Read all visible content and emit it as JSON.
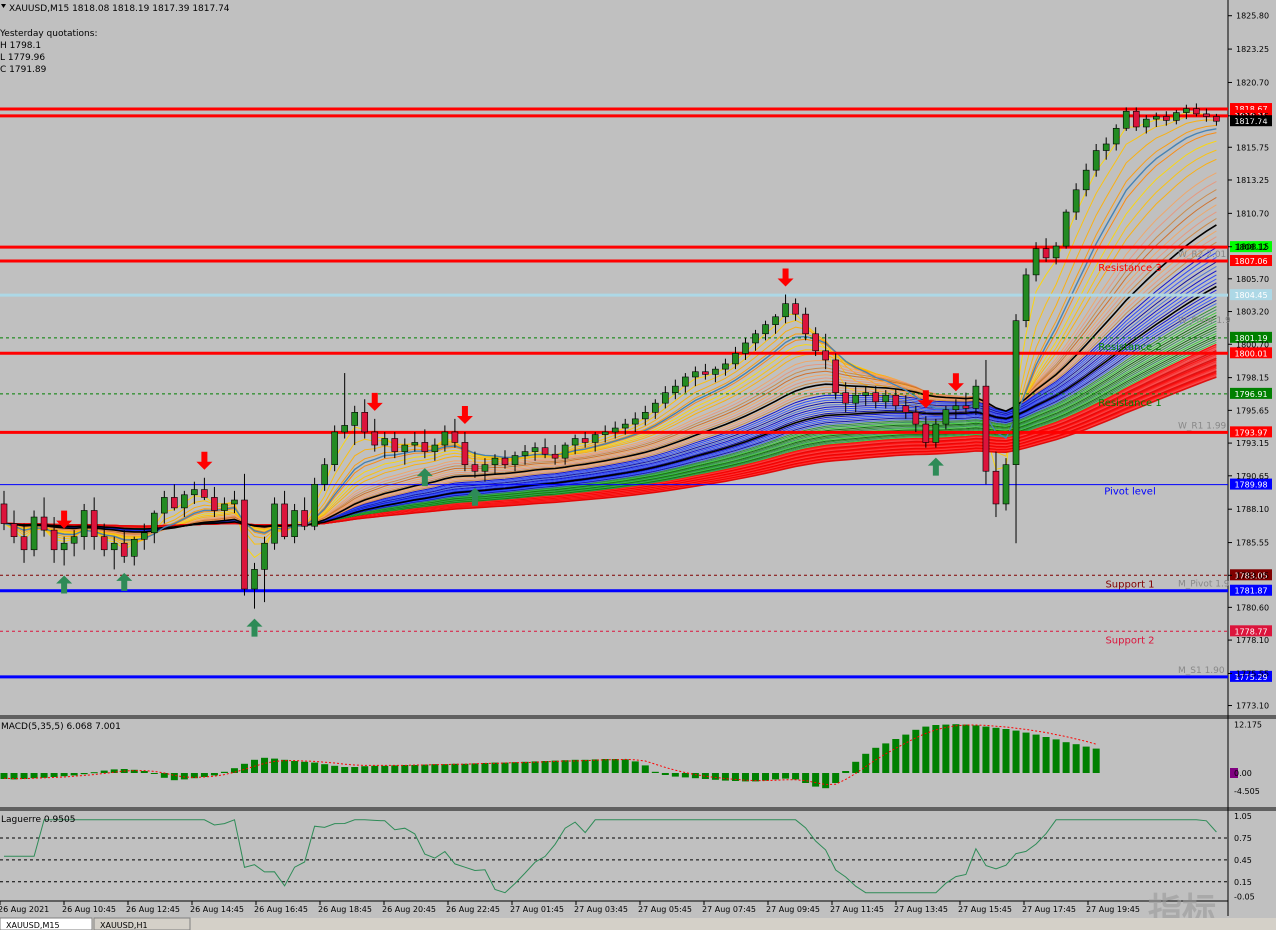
{
  "header": {
    "symbol_line": "XAUUSD,M15  1818.08 1818.19 1817.39 1817.74",
    "yesterday_title": "Yesterday quotations:",
    "yesterday_h": "H 1798.1",
    "yesterday_l": "L 1779.96",
    "yesterday_c": "C 1791.89"
  },
  "price_axis": {
    "ticks": [
      "1825.80",
      "1823.25",
      "1820.70",
      "1818.15",
      "1815.75",
      "1813.25",
      "1810.70",
      "1808.15",
      "1805.70",
      "1803.20",
      "1800.70",
      "1798.15",
      "1795.65",
      "1793.15",
      "1790.65",
      "1788.10",
      "1785.55",
      "1783.05",
      "1780.60",
      "1778.10",
      "1775.55",
      "1773.10"
    ],
    "tick_values": [
      1825.8,
      1823.25,
      1820.7,
      1818.15,
      1815.75,
      1813.25,
      1810.7,
      1808.15,
      1805.7,
      1803.2,
      1800.7,
      1798.15,
      1795.65,
      1793.15,
      1790.65,
      1788.1,
      1785.55,
      1783.05,
      1780.6,
      1778.1,
      1775.55,
      1773.1
    ],
    "ylim": [
      1772.3,
      1827.0
    ]
  },
  "levels": [
    {
      "value": 1818.67,
      "label": "1818.67",
      "name": "",
      "color": "#ff0000",
      "kind": "thick"
    },
    {
      "value": 1818.15,
      "label": "1818.15",
      "name": "",
      "color": "#ff0000",
      "kind": "thick"
    },
    {
      "value": 1817.74,
      "label": "1817.74",
      "name": "",
      "color": "#000000",
      "kind": "price"
    },
    {
      "value": 1808.12,
      "label": "1808.12",
      "name": "",
      "color": "#ff0000",
      "kind": "thick",
      "tag": "#00ff00"
    },
    {
      "value": 1807.06,
      "label": "1807.06",
      "name": "Resistance 3",
      "color": "#ff0000",
      "kind": "thick"
    },
    {
      "value": 1804.45,
      "label": "1804.45",
      "name": "",
      "color": "#add8e6",
      "kind": "thick"
    },
    {
      "value": 1801.19,
      "label": "1801.19",
      "name": "Resistance 2",
      "color": "#008000",
      "kind": "dash"
    },
    {
      "value": 1800.01,
      "label": "1800.01",
      "name": "",
      "color": "#ff0000",
      "kind": "thick"
    },
    {
      "value": 1796.91,
      "label": "1796.91",
      "name": "Resistance 1",
      "color": "#008000",
      "kind": "dash"
    },
    {
      "value": 1793.97,
      "label": "1793.97",
      "name": "",
      "color": "#ff0000",
      "kind": "thick"
    },
    {
      "value": 1789.98,
      "label": "1789.98",
      "name": "Pivot level",
      "color": "#0000ff",
      "kind": "thin"
    },
    {
      "value": 1783.05,
      "label": "1783.05",
      "name": "Support 1",
      "color": "#800000",
      "kind": "dash"
    },
    {
      "value": 1781.87,
      "label": "1781.87",
      "name": "",
      "color": "#0000ff",
      "kind": "thick"
    },
    {
      "value": 1778.77,
      "label": "1778.77",
      "name": "Support 2",
      "color": "#dc143c",
      "kind": "dash"
    },
    {
      "value": 1775.29,
      "label": "1775.29",
      "name": "",
      "color": "#0000ff",
      "kind": "thick"
    }
  ],
  "side_labels": [
    "W_R1 1.99",
    "M_Pivot 1.9",
    "M_S1 1.90",
    "W_R2 2.01",
    "W_Pivot 1.9"
  ],
  "time_axis": [
    "26 Aug 2021",
    "26 Aug 10:45",
    "26 Aug 12:45",
    "26 Aug 14:45",
    "26 Aug 16:45",
    "26 Aug 18:45",
    "26 Aug 20:45",
    "26 Aug 22:45",
    "27 Aug 01:45",
    "27 Aug 03:45",
    "27 Aug 05:45",
    "27 Aug 07:45",
    "27 Aug 09:45",
    "27 Aug 11:45",
    "27 Aug 13:45",
    "27 Aug 15:45",
    "27 Aug 17:45",
    "27 Aug 19:45"
  ],
  "macd": {
    "label": "MACD(5,35,5) 6.068 7.001",
    "ticks": [
      "12.175",
      "0.00",
      "-4.505"
    ],
    "tick_values": [
      12.175,
      0,
      -4.505
    ],
    "ylim": [
      -8.5,
      13.5
    ]
  },
  "laguerre": {
    "label": "Laguerre 0.9505",
    "ticks": [
      "1.05",
      "0.75",
      "0.45",
      "0.15",
      "-0.05"
    ],
    "tick_values": [
      1.05,
      0.75,
      0.45,
      0.15,
      -0.05
    ],
    "ylim": [
      -0.1,
      1.12
    ]
  },
  "watermark": "指标",
  "tabs": [
    "XAUUSD,M15",
    "XAUUSD,H1"
  ],
  "colors": {
    "bull": "#228b22",
    "bear": "#dc143c",
    "arrow_up": "#2e8b57",
    "arrow_down": "#ff0000",
    "background": "#c0c0c0"
  },
  "chart_data": {
    "type": "candlestick",
    "symbol": "XAUUSD",
    "timeframe": "M15",
    "candles": [
      [
        1788.5,
        1789.5,
        1786.5,
        1787
      ],
      [
        1787,
        1788,
        1785.5,
        1786
      ],
      [
        1786,
        1787,
        1784,
        1785
      ],
      [
        1785,
        1788,
        1784.5,
        1787.5
      ],
      [
        1787.5,
        1789,
        1786,
        1786.5
      ],
      [
        1786.5,
        1787.5,
        1784,
        1785
      ],
      [
        1785,
        1786,
        1783.8,
        1785.5
      ],
      [
        1785.5,
        1786.5,
        1784.5,
        1786
      ],
      [
        1786,
        1788.5,
        1785,
        1788
      ],
      [
        1788,
        1789,
        1785,
        1786
      ],
      [
        1786,
        1787,
        1784.5,
        1785
      ],
      [
        1785,
        1786,
        1783.5,
        1785.5
      ],
      [
        1785.5,
        1786.5,
        1784,
        1784.5
      ],
      [
        1784.5,
        1786,
        1783.8,
        1785.8
      ],
      [
        1785.8,
        1787,
        1785,
        1786.3
      ],
      [
        1786.3,
        1788,
        1785.5,
        1787.8
      ],
      [
        1787.8,
        1789.5,
        1787,
        1789
      ],
      [
        1789,
        1790,
        1788,
        1788.2
      ],
      [
        1788.2,
        1789.5,
        1787.5,
        1789.2
      ],
      [
        1789.2,
        1790.2,
        1788.5,
        1789.6
      ],
      [
        1789.6,
        1790.5,
        1788.8,
        1789
      ],
      [
        1789,
        1789.8,
        1787.5,
        1788
      ],
      [
        1788,
        1789,
        1787.2,
        1788.5
      ],
      [
        1788.5,
        1789.5,
        1787.8,
        1788.8
      ],
      [
        1788.8,
        1790.8,
        1781.5,
        1782
      ],
      [
        1782,
        1784,
        1780.5,
        1783.5
      ],
      [
        1783.5,
        1786,
        1781,
        1785.5
      ],
      [
        1785.5,
        1789,
        1785,
        1788.5
      ],
      [
        1788.5,
        1789.5,
        1785.8,
        1786
      ],
      [
        1786,
        1788.5,
        1785.5,
        1788
      ],
      [
        1788,
        1789,
        1786.5,
        1786.8
      ],
      [
        1786.8,
        1790.5,
        1786.5,
        1790
      ],
      [
        1790,
        1792,
        1789.5,
        1791.5
      ],
      [
        1791.5,
        1794.5,
        1791,
        1794
      ],
      [
        1794,
        1798.5,
        1793.5,
        1794.5
      ],
      [
        1794.5,
        1796,
        1793,
        1795.5
      ],
      [
        1795.5,
        1796.5,
        1793.5,
        1794
      ],
      [
        1794,
        1795,
        1792.5,
        1793
      ],
      [
        1793,
        1794,
        1792,
        1793.5
      ],
      [
        1793.5,
        1794,
        1792,
        1792.5
      ],
      [
        1792.5,
        1793.5,
        1791.5,
        1793
      ],
      [
        1793,
        1794,
        1792.5,
        1793.2
      ],
      [
        1793.2,
        1794.2,
        1792,
        1792.5
      ],
      [
        1792.5,
        1793.5,
        1791.8,
        1793
      ],
      [
        1793,
        1794.5,
        1792.5,
        1794
      ],
      [
        1794,
        1795,
        1792.8,
        1793.2
      ],
      [
        1793.2,
        1794,
        1791,
        1791.5
      ],
      [
        1791.5,
        1792.5,
        1790.5,
        1791
      ],
      [
        1791,
        1792,
        1790.2,
        1791.5
      ],
      [
        1791.5,
        1792.3,
        1790.8,
        1792
      ],
      [
        1792,
        1792.6,
        1791.2,
        1791.5
      ],
      [
        1791.5,
        1792.5,
        1791,
        1792.2
      ],
      [
        1792.2,
        1793,
        1791.5,
        1792.5
      ],
      [
        1792.5,
        1793.2,
        1791.8,
        1792.8
      ],
      [
        1792.8,
        1793.5,
        1792,
        1792.3
      ],
      [
        1792.3,
        1793,
        1791.5,
        1792
      ],
      [
        1792,
        1793.2,
        1791.5,
        1793
      ],
      [
        1793,
        1793.8,
        1792.3,
        1793.5
      ],
      [
        1793.5,
        1794,
        1792.8,
        1793.2
      ],
      [
        1793.2,
        1794,
        1792.5,
        1793.8
      ],
      [
        1793.8,
        1794.5,
        1793.2,
        1794
      ],
      [
        1794,
        1794.8,
        1793.5,
        1794.3
      ],
      [
        1794.3,
        1795,
        1793.8,
        1794.6
      ],
      [
        1794.6,
        1795.5,
        1794,
        1795
      ],
      [
        1795,
        1796,
        1794.5,
        1795.5
      ],
      [
        1795.5,
        1796.5,
        1795,
        1796.2
      ],
      [
        1796.2,
        1797.5,
        1795.8,
        1797
      ],
      [
        1797,
        1798,
        1796.5,
        1797.5
      ],
      [
        1797.5,
        1798.5,
        1797,
        1798.2
      ],
      [
        1798.2,
        1799,
        1797.5,
        1798.6
      ],
      [
        1798.6,
        1799.2,
        1798,
        1798.4
      ],
      [
        1798.4,
        1799,
        1797.8,
        1798.8
      ],
      [
        1798.8,
        1799.6,
        1798.3,
        1799.2
      ],
      [
        1799.2,
        1800.5,
        1798.8,
        1800
      ],
      [
        1800,
        1801.2,
        1799.5,
        1800.8
      ],
      [
        1800.8,
        1801.8,
        1800.2,
        1801.5
      ],
      [
        1801.5,
        1802.5,
        1801,
        1802.2
      ],
      [
        1802.2,
        1803,
        1801.5,
        1802.8
      ],
      [
        1802.8,
        1804.5,
        1802.3,
        1803.8
      ],
      [
        1803.8,
        1804.2,
        1802.5,
        1803
      ],
      [
        1803,
        1803.5,
        1801,
        1801.5
      ],
      [
        1801.5,
        1802,
        1799.8,
        1800.2
      ],
      [
        1800.2,
        1801.5,
        1798.8,
        1799.5
      ],
      [
        1799.5,
        1800,
        1796.5,
        1797
      ],
      [
        1797,
        1797.8,
        1795.5,
        1796.2
      ],
      [
        1796.2,
        1797.5,
        1795.5,
        1796.8
      ],
      [
        1796.8,
        1797.5,
        1796,
        1797
      ],
      [
        1797,
        1797.5,
        1795.8,
        1796.3
      ],
      [
        1796.3,
        1797.2,
        1795.8,
        1796.8
      ],
      [
        1796.8,
        1797.3,
        1795.6,
        1796
      ],
      [
        1796,
        1796.8,
        1795,
        1795.5
      ],
      [
        1795.5,
        1796,
        1794,
        1794.6
      ],
      [
        1794.6,
        1795.2,
        1792.8,
        1793.2
      ],
      [
        1793.2,
        1795,
        1792.8,
        1794.6
      ],
      [
        1794.6,
        1796,
        1794.2,
        1795.7
      ],
      [
        1795.7,
        1796.5,
        1795,
        1796
      ],
      [
        1796,
        1797,
        1795.5,
        1795.8
      ],
      [
        1795.8,
        1798,
        1795.3,
        1797.5
      ],
      [
        1797.5,
        1799.5,
        1790,
        1791
      ],
      [
        1791,
        1792.5,
        1787.5,
        1788.5
      ],
      [
        1788.5,
        1792,
        1788,
        1791.5
      ],
      [
        1791.5,
        1803,
        1785.5,
        1802.5
      ],
      [
        1802.5,
        1806.5,
        1802,
        1806
      ],
      [
        1806,
        1808.5,
        1805.5,
        1808
      ],
      [
        1808,
        1808.8,
        1807,
        1807.3
      ],
      [
        1807.3,
        1808.5,
        1806.8,
        1808.2
      ],
      [
        1808.2,
        1811,
        1808,
        1810.8
      ],
      [
        1810.8,
        1813,
        1810.2,
        1812.5
      ],
      [
        1812.5,
        1814.5,
        1812,
        1814
      ],
      [
        1814,
        1816,
        1813.5,
        1815.5
      ],
      [
        1815.5,
        1816.5,
        1814.8,
        1816
      ],
      [
        1816,
        1817.5,
        1815.5,
        1817.2
      ],
      [
        1817.2,
        1818.8,
        1817,
        1818.5
      ],
      [
        1818.5,
        1818.8,
        1817,
        1817.3
      ],
      [
        1817.3,
        1818.2,
        1816.8,
        1817.9
      ],
      [
        1817.9,
        1818.4,
        1817.3,
        1818.1
      ],
      [
        1818.1,
        1818.5,
        1817.4,
        1817.8
      ],
      [
        1817.8,
        1818.6,
        1817.5,
        1818.4
      ],
      [
        1818.4,
        1819,
        1817.9,
        1818.7
      ],
      [
        1818.7,
        1819.1,
        1818.1,
        1818.3
      ],
      [
        1818.3,
        1818.7,
        1817.7,
        1818.1
      ],
      [
        1818.1,
        1818.3,
        1817.4,
        1817.74
      ]
    ],
    "macd_histogram": [
      -1.5,
      -1.6,
      -1.5,
      -1.3,
      -1.2,
      -1,
      -0.8,
      -0.6,
      -0.3,
      0.2,
      0.6,
      0.9,
      1,
      0.8,
      0.5,
      0,
      -1.2,
      -1.8,
      -1.6,
      -1.3,
      -1,
      -0.6,
      0.3,
      1.2,
      2.3,
      3.3,
      3.8,
      3.6,
      3.3,
      3,
      2.8,
      2.6,
      2.2,
      1.8,
      1.5,
      1.5,
      1.7,
      1.8,
      1.8,
      1.9,
      2,
      2,
      2.1,
      2.2,
      2.2,
      2.3,
      2.3,
      2.4,
      2.5,
      2.6,
      2.6,
      2.7,
      2.8,
      2.9,
      3,
      3.1,
      3.2,
      3.3,
      3.3,
      3.4,
      3.5,
      3.5,
      3.4,
      2.9,
      1.9,
      0.3,
      -0.5,
      -0.9,
      -1.1,
      -1.3,
      -1.5,
      -1.7,
      -1.9,
      -2,
      -2.1,
      -2.1,
      -1.9,
      -1.6,
      -1.4,
      -1.6,
      -2.5,
      -3.4,
      -3.8,
      -2.5,
      0.5,
      2.8,
      4.8,
      6.3,
      7.4,
      8.5,
      9.6,
      10.8,
      11.6,
      12,
      12.1,
      12.2,
      12.1,
      11.9,
      11.6,
      11.3,
      11,
      10.6,
      10.1,
      9.6,
      9,
      8.4,
      7.7,
      7.2,
      6.6,
      6.1
    ],
    "macd_signal": [
      -1.3,
      -1.4,
      -1.4,
      -1.3,
      -1.2,
      -1.1,
      -1,
      -0.8,
      -0.6,
      -0.4,
      -0.1,
      0.2,
      0.5,
      0.6,
      0.6,
      0.4,
      0,
      -0.6,
      -1,
      -1.1,
      -1,
      -0.8,
      -0.4,
      0.2,
      0.9,
      1.7,
      2.4,
      2.9,
      3.1,
      3.1,
      3,
      2.9,
      2.7,
      2.5,
      2.2,
      2,
      1.9,
      1.9,
      1.9,
      1.9,
      1.9,
      2,
      2,
      2.1,
      2.1,
      2.2,
      2.2,
      2.3,
      2.4,
      2.4,
      2.5,
      2.6,
      2.6,
      2.7,
      2.8,
      2.9,
      3,
      3,
      3.1,
      3.2,
      3.3,
      3.3,
      3.4,
      3.3,
      3,
      2.2,
      1.4,
      0.7,
      0.1,
      -0.4,
      -0.8,
      -1.1,
      -1.4,
      -1.6,
      -1.8,
      -1.9,
      -1.9,
      -1.8,
      -1.7,
      -1.7,
      -1.9,
      -2.4,
      -2.9,
      -2.8,
      -1.6,
      -0.1,
      1.6,
      3.3,
      4.8,
      6.2,
      7.5,
      8.8,
      9.9,
      10.8,
      11.4,
      11.8,
      12,
      12,
      11.9,
      11.7,
      11.5,
      11.2,
      10.9,
      10.5,
      10.1,
      9.6,
      9.1,
      8.5,
      7.9,
      7.2
    ]
  }
}
